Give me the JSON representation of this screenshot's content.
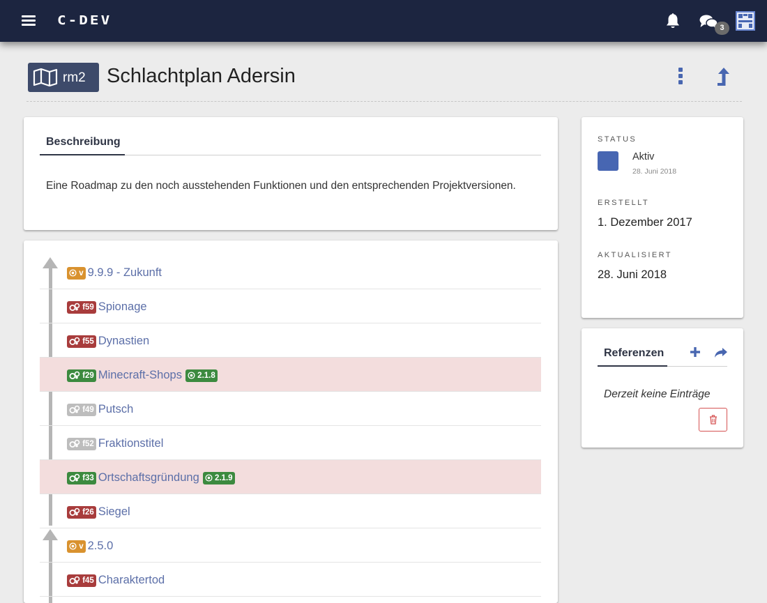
{
  "app": {
    "logo": "C-DEV",
    "notifications_badge": "3"
  },
  "header": {
    "badge_code": "rm2",
    "title": "Schlachtplan Adersin"
  },
  "description": {
    "tab_label": "Beschreibung",
    "text": "Eine Roadmap zu den noch ausstehenden Funktionen und den entsprechenden Projektversionen."
  },
  "roadmap": {
    "rows": [
      {
        "kind": "version",
        "tag": "v",
        "label": "9.9.9 - Zukunft",
        "highlighted": false
      },
      {
        "kind": "feature",
        "tag": "f59",
        "label": "Spionage",
        "color": "red",
        "highlighted": false
      },
      {
        "kind": "feature",
        "tag": "f55",
        "label": "Dynastien",
        "color": "red",
        "highlighted": false
      },
      {
        "kind": "feature",
        "tag": "f29",
        "label": "Minecraft-Shops",
        "color": "green",
        "version": "2.1.8",
        "highlighted": true
      },
      {
        "kind": "feature",
        "tag": "f49",
        "label": "Putsch",
        "color": "grey",
        "highlighted": false
      },
      {
        "kind": "feature",
        "tag": "f52",
        "label": "Fraktionstitel",
        "color": "grey",
        "highlighted": false
      },
      {
        "kind": "feature",
        "tag": "f33",
        "label": "Ortschaftsgründung",
        "color": "green",
        "version": "2.1.9",
        "highlighted": true
      },
      {
        "kind": "feature",
        "tag": "f26",
        "label": "Siegel",
        "color": "red",
        "highlighted": false
      },
      {
        "kind": "version",
        "tag": "v",
        "label": "2.5.0",
        "highlighted": false
      },
      {
        "kind": "feature",
        "tag": "f45",
        "label": "Charaktertod",
        "color": "red",
        "highlighted": false
      }
    ]
  },
  "status_panel": {
    "status_label": "STATUS",
    "status_value": "Aktiv",
    "status_date": "28. Juni 2018",
    "status_color": "#4766b2",
    "created_label": "ERSTELLT",
    "created_value": "1. Dezember 2017",
    "updated_label": "AKTUALISIERT",
    "updated_value": "28. Juni 2018"
  },
  "references": {
    "tab_label": "Referenzen",
    "empty_text": "Derzeit keine Einträge"
  },
  "colors": {
    "topbar": "#1c2540",
    "accent": "#4866b0",
    "link": "#5c6fa8",
    "tag_orange": "#d9922f",
    "tag_red": "#a83c3c",
    "tag_green": "#3c8a3f",
    "tag_grey": "#bdbdbd",
    "row_highlight": "#f3dddd"
  },
  "icons": {
    "menu": "hamburger-icon",
    "bell": "bell-icon",
    "chat": "chat-icon",
    "avatar": "avatar-icon",
    "map": "map-icon",
    "kebab": "kebab-icon",
    "upload": "upload-icon",
    "feature": "cogs-icon",
    "version": "target-icon",
    "add": "plus-icon",
    "share": "share-icon",
    "delete": "trash-icon"
  }
}
